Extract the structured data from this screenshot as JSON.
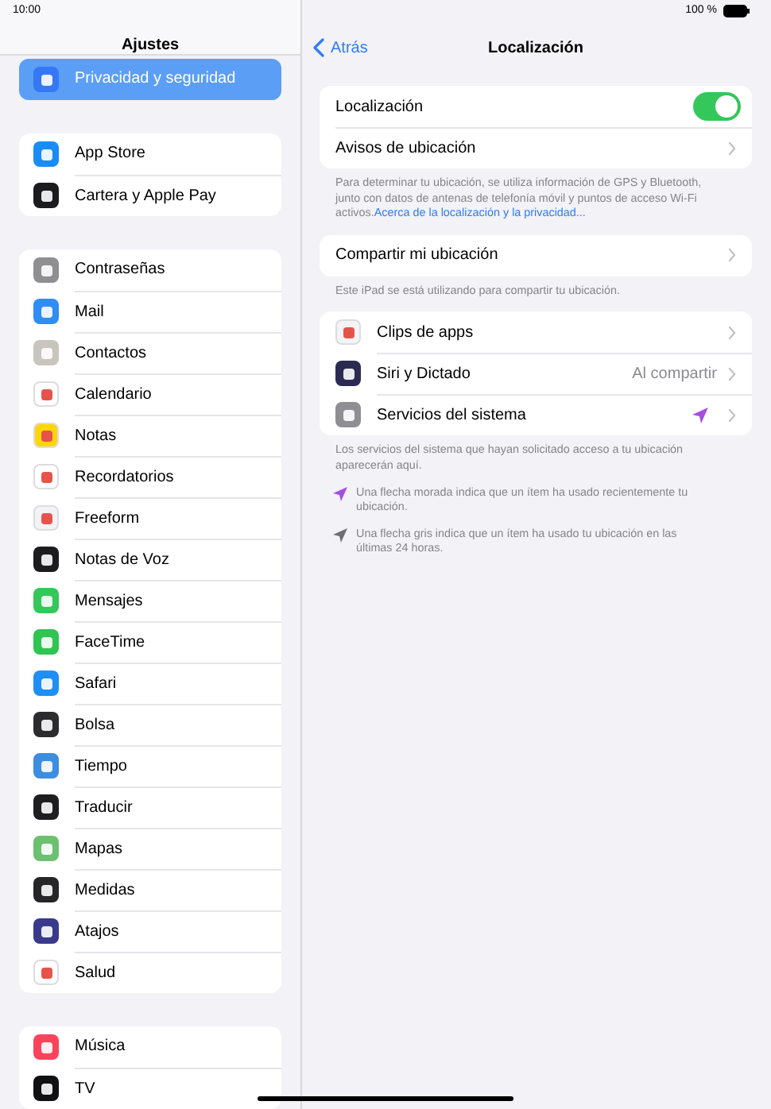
{
  "status_bar": {
    "time": "10:00",
    "battery": "100 %"
  },
  "sidebar": {
    "title": "Ajustes",
    "groups": [
      [
        {
          "label": "Privacidad y seguridad",
          "selected": true,
          "color": "#3478f6"
        }
      ],
      [
        {
          "label": "App Store",
          "selected": false,
          "color": "#1a8cf5"
        },
        {
          "label": "Cartera y Apple Pay",
          "selected": false,
          "color": "#1c1c1e"
        }
      ],
      [
        {
          "label": "Contraseñas",
          "selected": false,
          "color": "#8e8e93"
        },
        {
          "label": "Mail",
          "selected": false,
          "color": "#2f8df5"
        },
        {
          "label": "Contactos",
          "selected": false,
          "color": "#c9c4bd"
        },
        {
          "label": "Calendario",
          "selected": false,
          "color": "#ffffff"
        },
        {
          "label": "Notas",
          "selected": false,
          "color": "#ffd60a"
        },
        {
          "label": "Recordatorios",
          "selected": false,
          "color": "#ffffff"
        },
        {
          "label": "Freeform",
          "selected": false,
          "color": "#f2f2f7"
        },
        {
          "label": "Notas de Voz",
          "selected": false,
          "color": "#1c1c1e"
        },
        {
          "label": "Mensajes",
          "selected": false,
          "color": "#34c759"
        },
        {
          "label": "FaceTime",
          "selected": false,
          "color": "#30c452"
        },
        {
          "label": "Safari",
          "selected": false,
          "color": "#1f8ff5"
        },
        {
          "label": "Bolsa",
          "selected": false,
          "color": "#2c2c2e"
        },
        {
          "label": "Tiempo",
          "selected": false,
          "color": "#3d8de0"
        },
        {
          "label": "Traducir",
          "selected": false,
          "color": "#1e1e20"
        },
        {
          "label": "Mapas",
          "selected": false,
          "color": "#6cc070"
        },
        {
          "label": "Medidas",
          "selected": false,
          "color": "#262628"
        },
        {
          "label": "Atajos",
          "selected": false,
          "color": "#3a3a8c"
        },
        {
          "label": "Salud",
          "selected": false,
          "color": "#fefefe"
        }
      ],
      [
        {
          "label": "Música",
          "selected": false,
          "color": "#f9435a"
        },
        {
          "label": "TV",
          "selected": false,
          "color": "#101012"
        }
      ]
    ]
  },
  "nav": {
    "back": "Atrás",
    "title": "Localización"
  },
  "sections": [
    {
      "rows": [
        {
          "kind": "toggle",
          "label": "Localización",
          "on": true
        },
        {
          "kind": "link",
          "label": "Avisos de ubicación"
        }
      ],
      "footer": "Para determinar tu ubicación, se utiliza información de GPS y Bluetooth, junto con datos de antenas de telefonía móvil y puntos de acceso Wi-Fi activos.",
      "footer_link": "Acerca de la localización y la privacidad..."
    },
    {
      "rows": [
        {
          "kind": "link",
          "label": "Compartir mi ubicación"
        }
      ],
      "footer": "Este iPad se está utilizando para compartir tu ubicación."
    },
    {
      "rows": [
        {
          "kind": "app",
          "label": "Clips de apps",
          "color": "#f4f4f6"
        },
        {
          "kind": "app",
          "label": "Siri y Dictado",
          "color": "#2b2b52",
          "value": "Al compartir"
        },
        {
          "kind": "app",
          "label": "Servicios del sistema",
          "color": "#8e8e93",
          "location_arrow": {
            "color": "#a64ee0"
          }
        }
      ],
      "footer": "Los servicios del sistema que hayan solicitado acceso a tu ubicación aparecerán aquí."
    }
  ],
  "legend": [
    {
      "color": "#a64ee0",
      "text": "Una flecha morada indica que un ítem ha usado recientemente tu ubicación."
    },
    {
      "color": "#6e6e73",
      "text": "Una flecha gris indica que un ítem ha usado tu ubicación en las últimas 24 horas."
    }
  ]
}
